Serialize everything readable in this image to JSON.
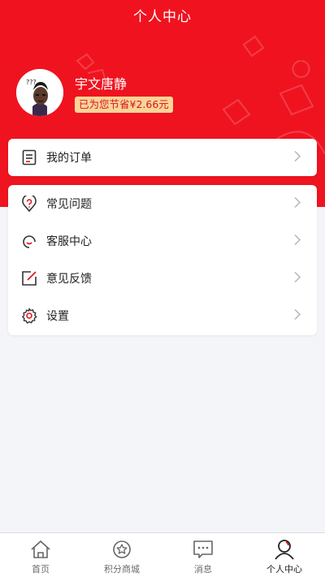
{
  "header": {
    "title": "个人中心"
  },
  "profile": {
    "name": "宇文唐静",
    "savings_badge": "已为您节省¥2.66元",
    "avatar_caption": "???"
  },
  "orders": {
    "label": "我的订单"
  },
  "menu": {
    "items": [
      {
        "label": "常见问题",
        "icon": "question-pin-icon"
      },
      {
        "label": "客服中心",
        "icon": "headset-icon"
      },
      {
        "label": "意见反馈",
        "icon": "edit-feedback-icon"
      },
      {
        "label": "设置",
        "icon": "gear-icon"
      }
    ]
  },
  "tabbar": {
    "tabs": [
      {
        "label": "首页",
        "icon": "home-icon"
      },
      {
        "label": "积分商城",
        "icon": "points-star-icon"
      },
      {
        "label": "消息",
        "icon": "message-icon"
      },
      {
        "label": "个人中心",
        "icon": "user-icon",
        "active": true
      }
    ]
  },
  "colors": {
    "accent": "#ee1420",
    "badge_bg": "#fbd497",
    "badge_text": "#d3171f",
    "background": "#f4f5f8"
  }
}
